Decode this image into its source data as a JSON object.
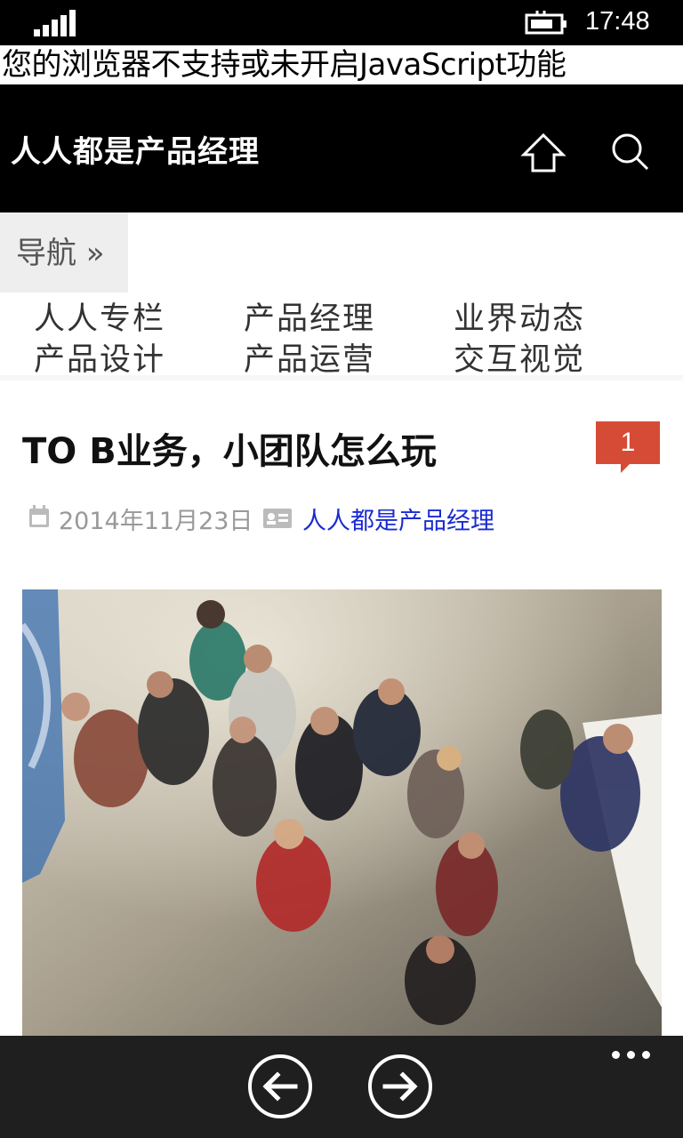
{
  "status_bar": {
    "time": "17:48",
    "signal_icon": "signal-bars-icon",
    "battery_icon": "battery-charging-icon"
  },
  "noscript_warning": "您的浏览器不支持或未开启JavaScript功能",
  "header": {
    "site_title": "人人都是产品经理",
    "home_icon": "home-icon",
    "search_icon": "search-icon"
  },
  "nav": {
    "toggle_label": "导航 »",
    "items": [
      {
        "label": "人人专栏"
      },
      {
        "label": "产品经理"
      },
      {
        "label": "业界动态"
      },
      {
        "label": "产品设计"
      },
      {
        "label": "产品运营"
      },
      {
        "label": "交互视觉"
      }
    ]
  },
  "article": {
    "title": "TO B业务，小团队怎么玩",
    "comment_count": "1",
    "date": "2014年11月23日",
    "author": "人人都是产品经理",
    "date_icon": "calendar-icon",
    "author_icon": "id-card-icon",
    "image_subject": "group-photo"
  },
  "app_bar": {
    "back_icon": "back-arrow-icon",
    "forward_icon": "forward-arrow-icon",
    "more_icon": "more-dots-icon"
  },
  "colors": {
    "header_bg": "#000000",
    "badge_bg": "#d64b35",
    "author_link": "#1a2bd1",
    "appbar_bg": "#1f1f1f"
  }
}
